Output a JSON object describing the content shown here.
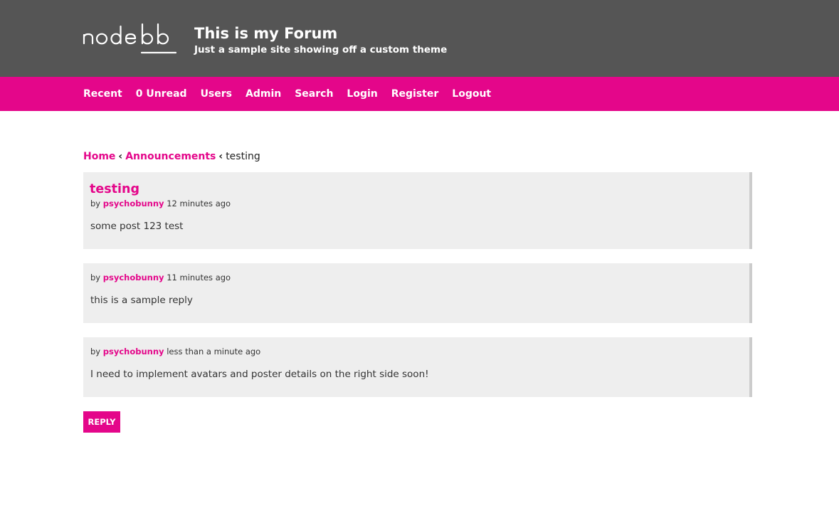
{
  "header": {
    "logo_text": "nodebb",
    "title": "This is my Forum",
    "subtitle": "Just a sample site showing off a custom theme"
  },
  "nav": {
    "items": [
      "Recent",
      "0 Unread",
      "Users",
      "Admin",
      "Search",
      "Login",
      "Register",
      "Logout"
    ]
  },
  "breadcrumb": {
    "home": "Home",
    "category": "Announcements",
    "current": "testing",
    "separator": "‹"
  },
  "topic": {
    "title": "testing"
  },
  "posts": [
    {
      "by": "by",
      "author": "psychobunny",
      "time": "12 minutes ago",
      "body": "some post 123 test"
    },
    {
      "by": "by",
      "author": "psychobunny",
      "time": "11 minutes ago",
      "body": "this is a sample reply"
    },
    {
      "by": "by",
      "author": "psychobunny",
      "time": "less than a minute ago",
      "body": "I need to implement avatars and poster details on the right side soon!"
    }
  ],
  "reply_button": "REPLY",
  "colors": {
    "accent": "#e4068a",
    "header_bg": "#555555",
    "post_bg": "#eeeeee"
  }
}
